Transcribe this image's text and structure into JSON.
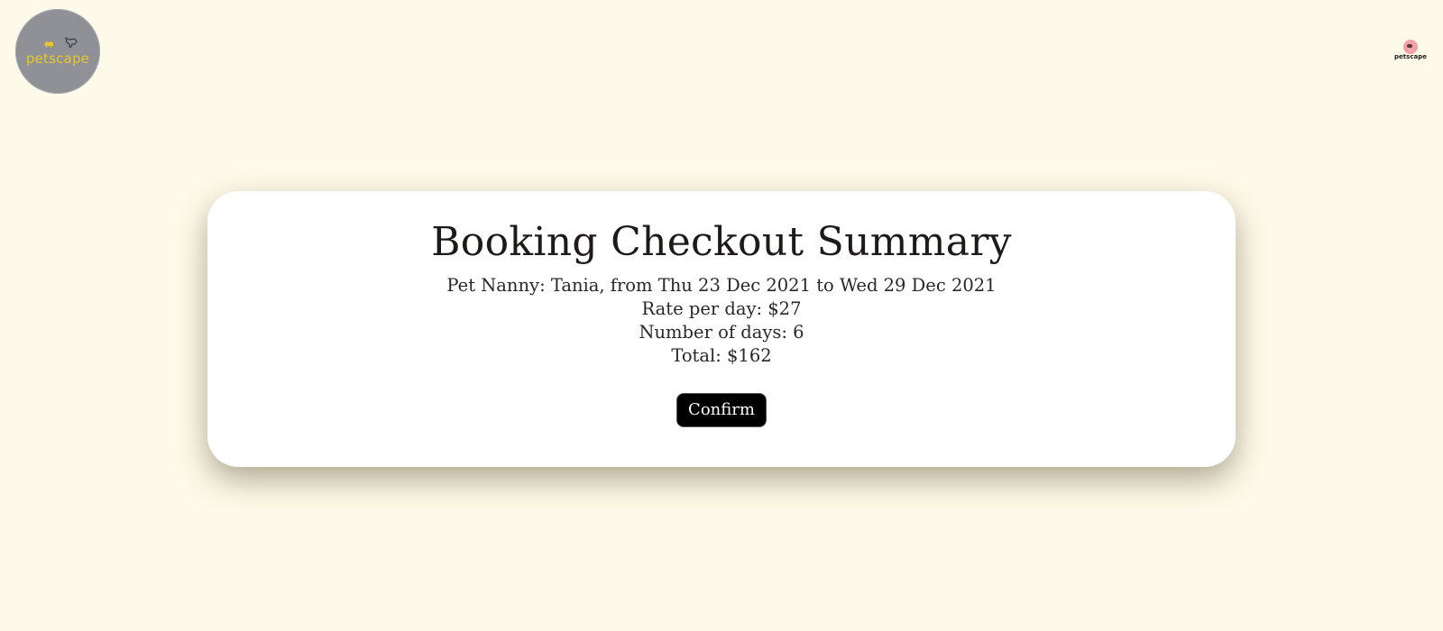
{
  "header": {
    "logo_text": "petscape",
    "small_logo_text": "petscape"
  },
  "booking": {
    "title": "Booking Checkout Summary",
    "nanny_line": "Pet Nanny: Tania, from Thu 23 Dec 2021 to Wed 29 Dec 2021",
    "rate_line": "Rate per day: $27",
    "days_line": "Number of days: 6",
    "total_line": "Total: $162",
    "confirm_label": "Confirm"
  },
  "colors": {
    "background": "#fefae9",
    "card": "#ffffff",
    "button": "#000000",
    "logo_circle": "#8f9196",
    "logo_text": "#e9c531",
    "small_logo_dot": "#f2a1a8"
  }
}
